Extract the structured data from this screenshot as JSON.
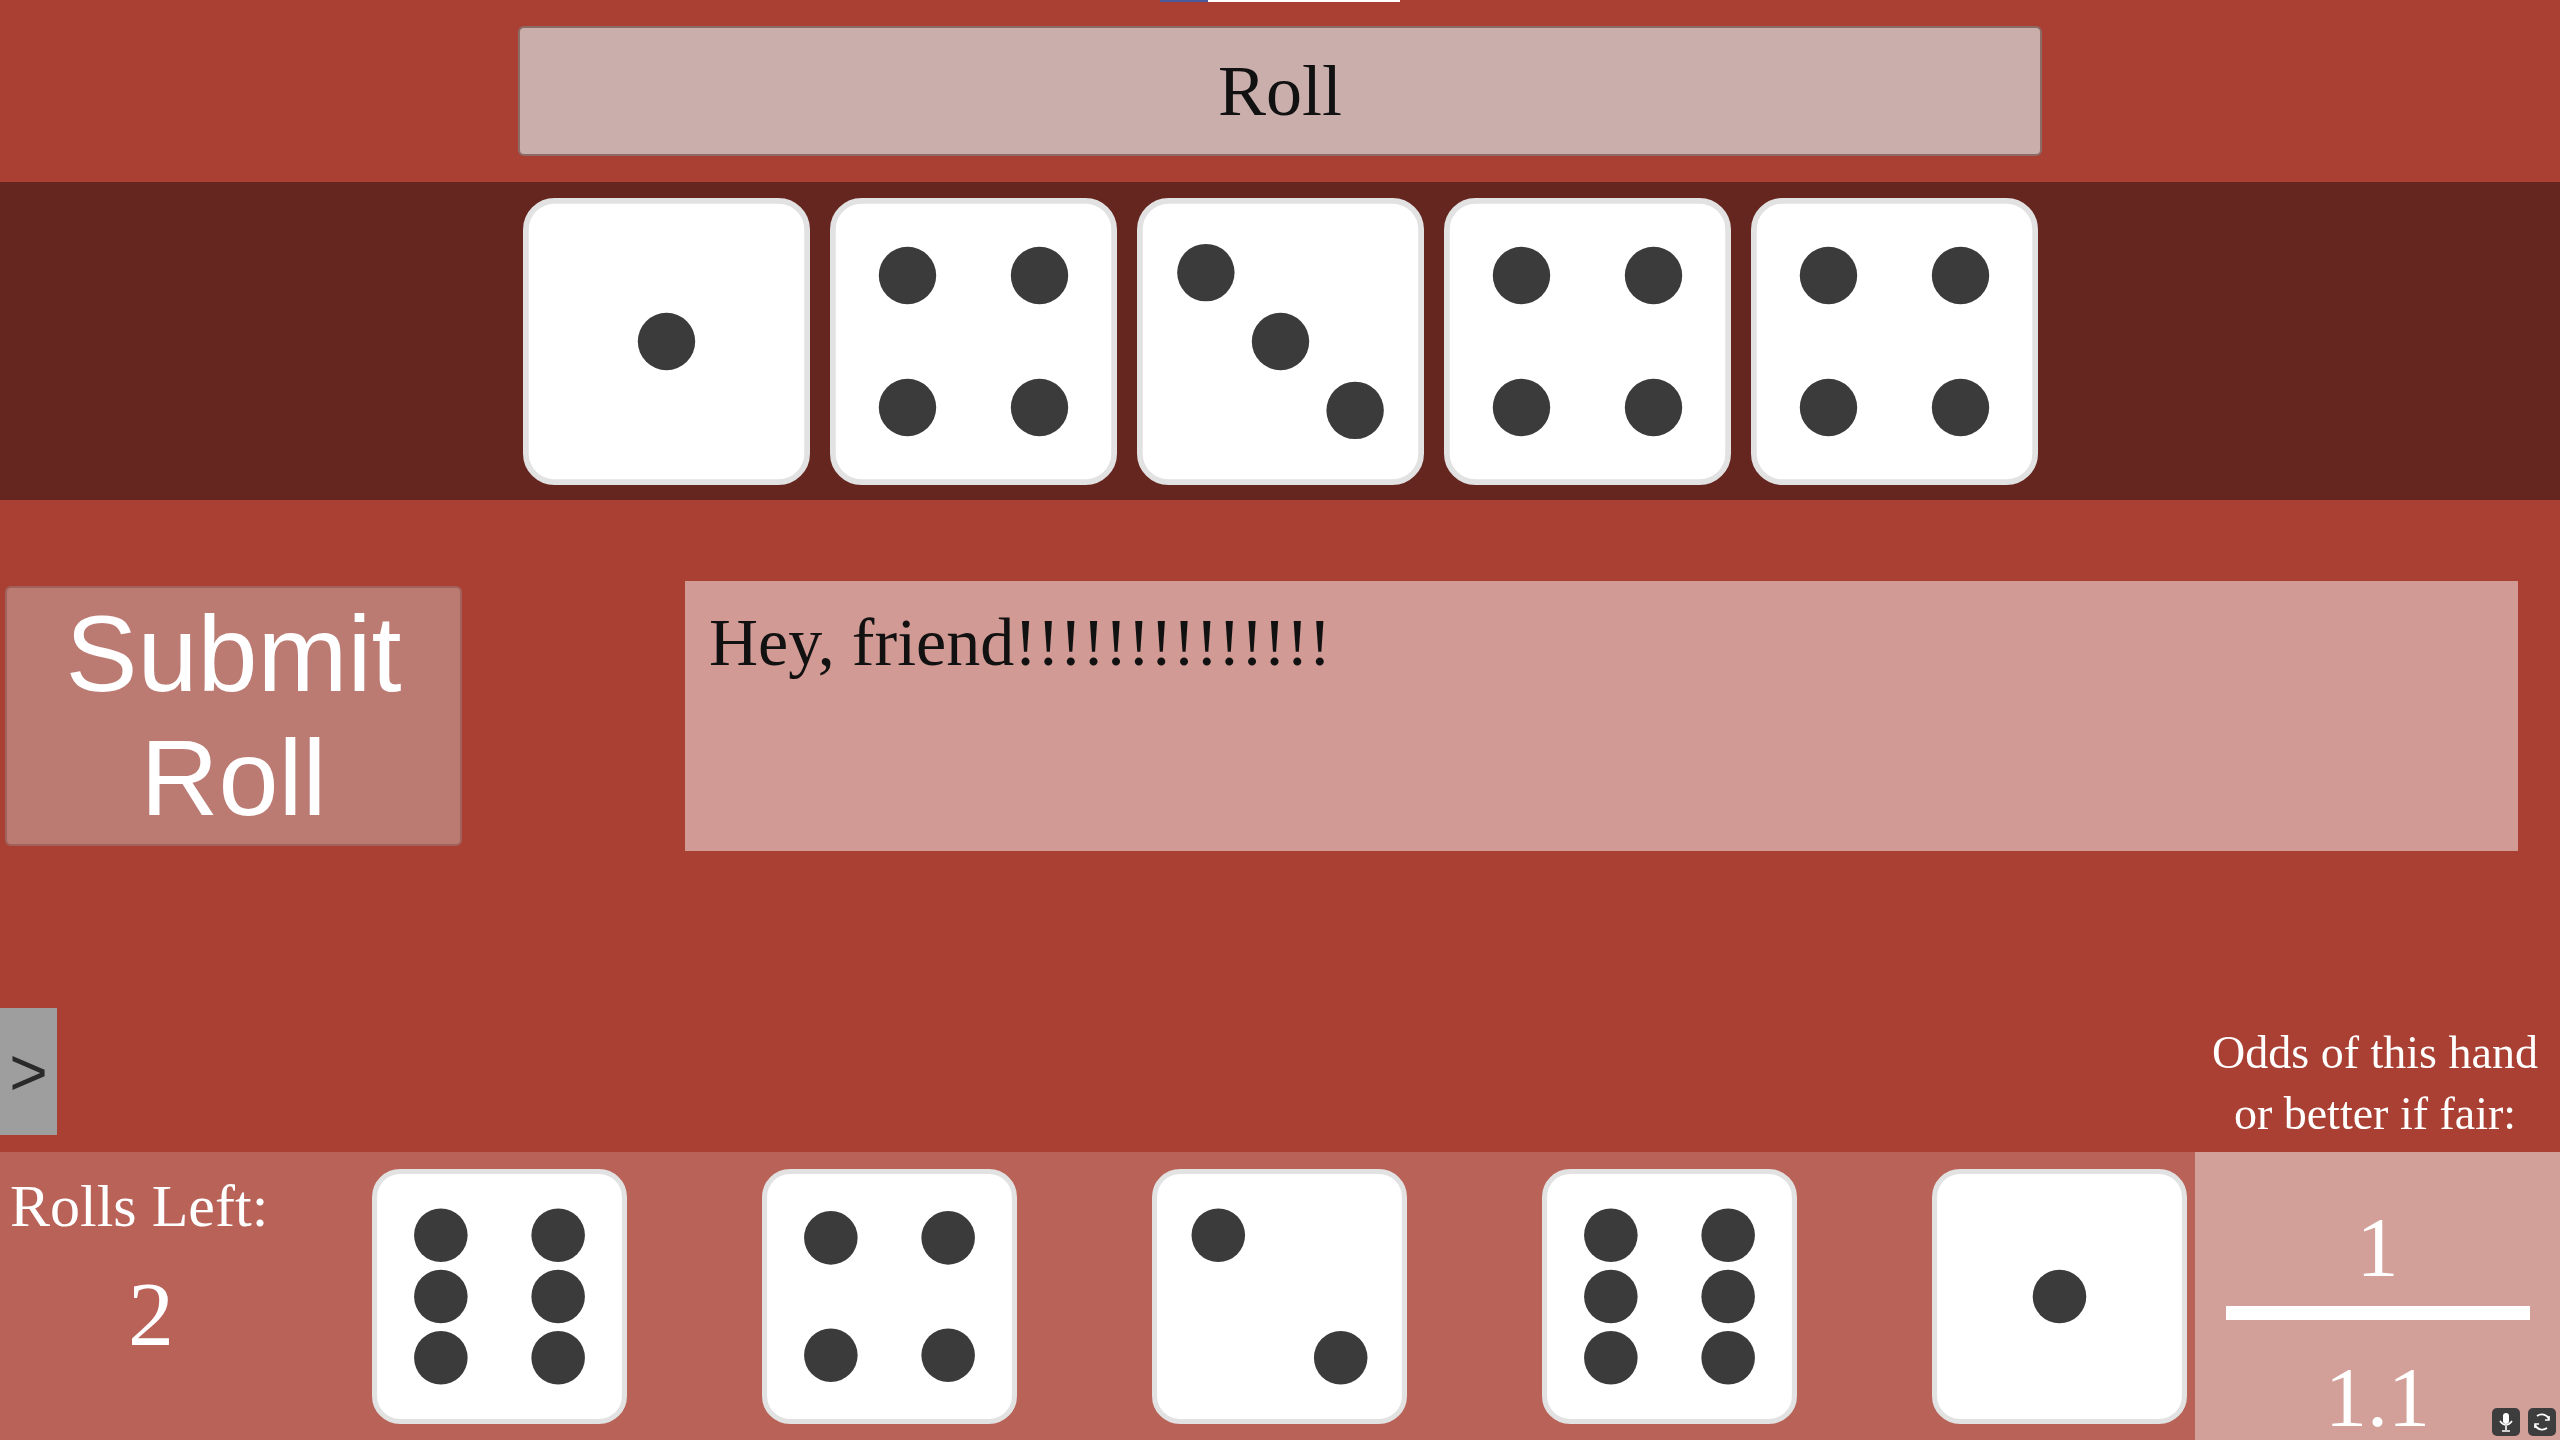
{
  "roll_button": {
    "label": "Roll"
  },
  "rolled_dice": [
    {
      "kind": "one"
    },
    {
      "kind": "four"
    },
    {
      "kind": "three"
    },
    {
      "kind": "four"
    },
    {
      "kind": "four"
    }
  ],
  "submit_button": {
    "label": "Submit\nRoll"
  },
  "message": "Hey, friend!!!!!!!!!!!!!!",
  "side_tab": {
    "label": ">"
  },
  "odds": {
    "label": "Odds of this hand\nor better if fair:",
    "numerator": "1",
    "denominator": "1.1"
  },
  "rolls_left": {
    "label": "Rolls Left:",
    "value": "2"
  },
  "held_dice": [
    {
      "kind": "six"
    },
    {
      "kind": "four"
    },
    {
      "kind": "two"
    },
    {
      "kind": "six"
    },
    {
      "kind": "one"
    }
  ]
}
